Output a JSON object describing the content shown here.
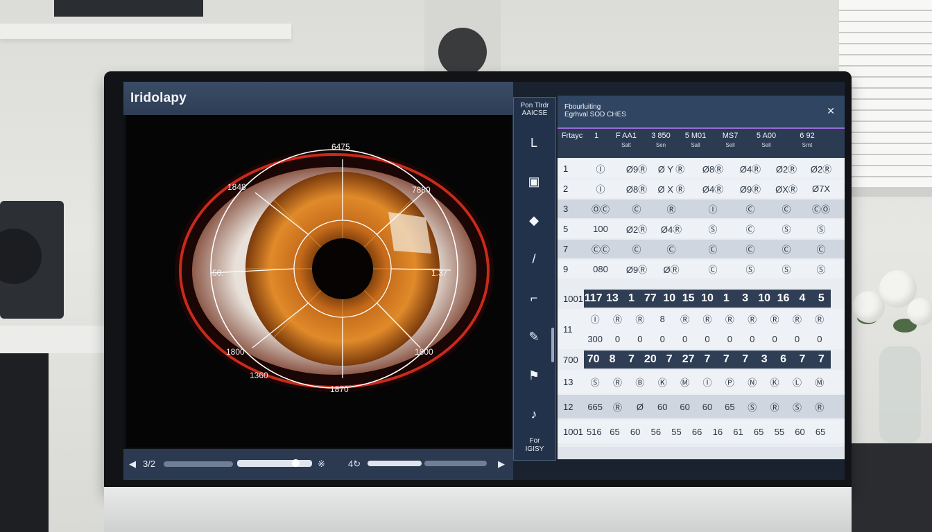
{
  "app": {
    "title": "Iridolapy"
  },
  "eye": {
    "labels": {
      "top": "6475",
      "top_left": "1848",
      "top_right": "7880",
      "left": "50.",
      "right": "1.37",
      "bottom_left": "1800",
      "bottom_left2": "1360",
      "bottom_right": "1800",
      "bottom": "1870"
    }
  },
  "playbar": {
    "prev_icon": "play-back-icon",
    "time_label": "3/2",
    "mid_label_1": "※",
    "mid_label_2": "4↻",
    "next_icon": "play-forward-icon",
    "progress": 0.78
  },
  "rail": {
    "header": [
      "Pon Tlrdr",
      "AAICSE"
    ],
    "footer": [
      "For",
      "IGISY"
    ],
    "tools": [
      {
        "icon": "corner-icon",
        "glyph": "L"
      },
      {
        "icon": "calendar-icon",
        "glyph": "▣"
      },
      {
        "icon": "fill-icon",
        "glyph": "◆"
      },
      {
        "icon": "pen-icon",
        "glyph": "/"
      },
      {
        "icon": "crop-icon",
        "glyph": "⌐"
      },
      {
        "icon": "eraser-icon",
        "glyph": "✎"
      },
      {
        "icon": "flag-icon",
        "glyph": "⚑"
      },
      {
        "icon": "note-icon",
        "glyph": "♪"
      }
    ]
  },
  "panel": {
    "title_line1": "Fbourluiting",
    "title_line2": "Egrhval SOD CHES",
    "close_icon": "close-icon",
    "header": [
      {
        "top": "Frtayc",
        "sub": ""
      },
      {
        "top": "1",
        "sub": ""
      },
      {
        "top": "F AA1",
        "sub": "Salt"
      },
      {
        "top": "3 850",
        "sub": "Sen"
      },
      {
        "top": "5 M01",
        "sub": "Sall"
      },
      {
        "top": "MS7",
        "sub": "Sell"
      },
      {
        "top": "5 A00",
        "sub": "Sell"
      },
      {
        "top": "6 92",
        "sub": "Srnt"
      }
    ],
    "rows": [
      {
        "id": "1",
        "cells": [
          "Ⓘ",
          "Ø9Ⓡ",
          "Ø Y Ⓡ",
          "Ø8Ⓡ",
          "Ø4Ⓡ",
          "Ø2Ⓡ",
          "Ø2Ⓡ"
        ],
        "style": "norm"
      },
      {
        "id": "2",
        "cells": [
          "Ⓘ",
          "Ø8Ⓡ",
          "Ø X Ⓡ",
          "Ø4Ⓡ",
          "Ø9Ⓡ",
          "ØXⓇ",
          "Ø7X"
        ],
        "style": "norm"
      },
      {
        "id": "3",
        "cells": [
          "ⓄⒸ",
          "Ⓒ",
          "Ⓡ",
          "Ⓘ",
          "Ⓒ",
          "Ⓒ",
          "ⒸⓄ"
        ],
        "style": "alt"
      },
      {
        "id": "5",
        "cells": [
          "100",
          "Ø2Ⓡ",
          "Ø4Ⓡ",
          "Ⓢ",
          "Ⓒ",
          "Ⓢ",
          "Ⓢ"
        ],
        "style": "norm"
      },
      {
        "id": "7",
        "cells": [
          "ⒸⒸ",
          "Ⓒ",
          "Ⓒ",
          "Ⓒ",
          "Ⓒ",
          "Ⓒ",
          "Ⓒ"
        ],
        "style": "alt"
      },
      {
        "id": "9",
        "cells": [
          "080",
          "Ø9Ⓡ",
          "ØⓇ",
          "Ⓒ",
          "Ⓢ",
          "Ⓢ",
          "Ⓢ"
        ],
        "style": "norm"
      }
    ],
    "band1": {
      "id": "1001",
      "values": [
        "117",
        "13",
        "1",
        "77",
        "10",
        "15",
        "10",
        "1",
        "3",
        "10",
        "16",
        "4",
        "5"
      ]
    },
    "row11": {
      "id": "11",
      "line1": [
        "Ⓘ",
        "Ⓡ",
        "Ⓡ",
        "8",
        "Ⓡ",
        "Ⓡ",
        "Ⓡ",
        "Ⓡ",
        "Ⓡ",
        "Ⓡ",
        "Ⓡ"
      ],
      "line2": [
        "300",
        "0",
        "0",
        "0",
        "0",
        "0",
        "0",
        "0",
        "0",
        "0",
        "0"
      ]
    },
    "band2": {
      "id": "700",
      "values": [
        "70",
        "8",
        "7",
        "20",
        "7",
        "27",
        "7",
        "7",
        "7",
        "3",
        "6",
        "7",
        "7"
      ]
    },
    "rows_b": [
      {
        "id": "13",
        "cells": [
          "Ⓢ",
          "Ⓡ",
          "Ⓑ",
          "Ⓚ",
          "Ⓜ",
          "Ⓘ",
          "Ⓟ",
          "Ⓝ",
          "Ⓚ",
          "Ⓛ",
          "Ⓜ"
        ],
        "style": "norm"
      },
      {
        "id": "12",
        "cells": [
          "665",
          "Ⓡ",
          "Ø",
          "60",
          "60",
          "60",
          "65",
          "Ⓢ",
          "Ⓡ",
          "Ⓢ",
          "Ⓡ"
        ],
        "style": "alt"
      },
      {
        "id": "1001",
        "cells": [
          "516",
          "65",
          "60",
          "56",
          "55",
          "66",
          "16",
          "61",
          "65",
          "55",
          "60",
          "65"
        ],
        "style": "norm"
      }
    ]
  },
  "colors": {
    "accent": "#9a6ad6",
    "header": "#2f4562",
    "iris": "#b8661c"
  }
}
